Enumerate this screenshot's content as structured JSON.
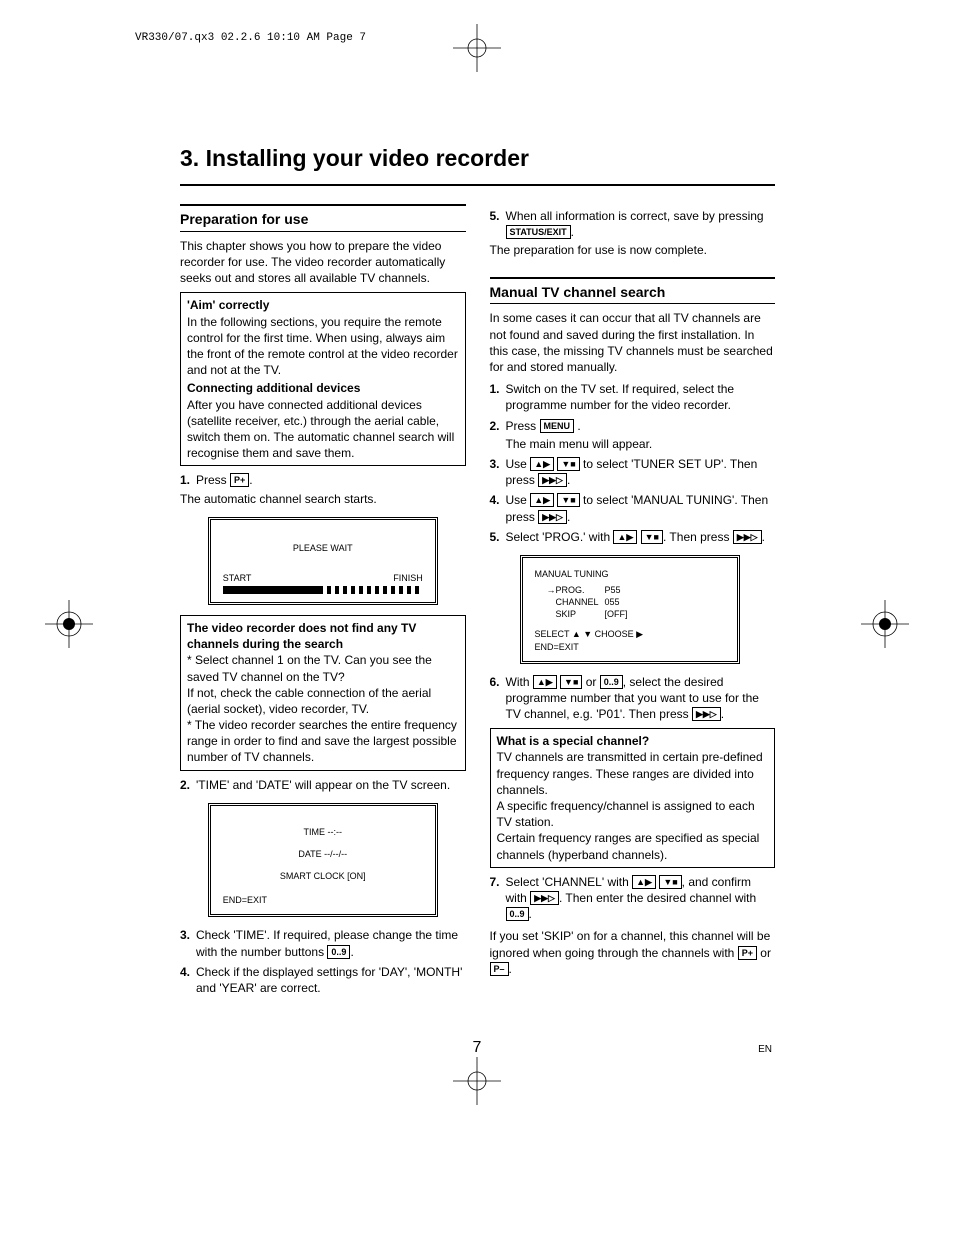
{
  "header": "VR330/07.qx3  02.2.6  10:10 AM  Page 7",
  "title": "3. Installing your video recorder",
  "left": {
    "section1": "Preparation for use",
    "intro": "This chapter shows you how to prepare the video recorder for use. The video recorder automatically seeks out and stores all available TV channels.",
    "box1_h1": "'Aim' correctly",
    "box1_p1": "In the following sections, you require the remote control for the first time. When using, always aim the front of the remote control at the video recorder and not at the TV.",
    "box1_h2": "Connecting additional devices",
    "box1_p2": "After you have connected additional devices (satellite receiver, etc.) through the aerial cable, switch them on. The automatic channel search will recognise them and save them.",
    "s1_pre": "Press ",
    "s1_post": ".",
    "s1_after": "The automatic channel search starts.",
    "osd1_wait": "PLEASE WAIT",
    "osd1_start": "START",
    "osd1_finish": "FINISH",
    "box2_h": "The video recorder does not find any TV channels during the search",
    "box2_l1": "* Select channel 1 on the TV. Can you see the saved TV channel on the TV?",
    "box2_l2": "If not, check the cable connection of the aerial (aerial socket), video recorder, TV.",
    "box2_l3": "* The video recorder searches the entire frequency range in order to find and save the largest possible number of TV channels.",
    "s2": "'TIME' and 'DATE' will appear on the TV screen.",
    "osd2_time": "TIME --:--",
    "osd2_date": "DATE --/--/--",
    "osd2_clock": "SMART CLOCK [ON]",
    "osd2_end": "END=EXIT",
    "s3_a": "Check 'TIME'. If required, please change the time with the number buttons ",
    "s3_b": ".",
    "s4": "Check if the displayed settings for 'DAY', 'MONTH' and 'YEAR' are correct."
  },
  "right": {
    "s5_a": "When all information is correct, save by pressing ",
    "s5_b": ".",
    "s5_after": "The preparation for use is now complete.",
    "section2": "Manual TV channel search",
    "intro2": "In some cases it can occur that all TV channels are not found and saved during the first installation. In this case, the missing TV channels must be searched for and stored manually.",
    "r1": "Switch on the TV set. If required, select the programme number for the video recorder.",
    "r2_a": "Press ",
    "r2_c": "   .",
    "r2_after": "The main menu will appear.",
    "r3_a": "Use ",
    "r3_b": " to select 'TUNER SET UP'. Then press ",
    "r3_c": ".",
    "r4_a": "Use ",
    "r4_b": " to select 'MANUAL TUNING'. Then press ",
    "r4_c": ".",
    "r5_a": "Select 'PROG.' with ",
    "r5_b": ". Then press ",
    "r5_c": ".",
    "osd3_title": "MANUAL TUNING",
    "osd3_prog": "→PROG.",
    "osd3_prog_v": "P55",
    "osd3_ch": "CHANNEL",
    "osd3_ch_v": "055",
    "osd3_skip": "SKIP",
    "osd3_skip_v": "[OFF]",
    "osd3_foot1": "SELECT ▲ ▼   CHOOSE ▶",
    "osd3_foot2": "END=EXIT",
    "r6_a": "With ",
    "r6_b": " or ",
    "r6_c": ", select the desired programme number that you want to use for the TV channel, e.g. 'P01'. Then press ",
    "r6_d": ".",
    "box3_h": "What is a special channel?",
    "box3_p1": "TV channels are transmitted in certain pre-defined frequency ranges. These ranges are divided into channels.",
    "box3_p2": "A specific frequency/channel is assigned to each TV station.",
    "box3_p3": "Certain frequency ranges are specified as special channels (hyperband channels).",
    "r7_a": "Select 'CHANNEL' with ",
    "r7_b": ", and confirm with ",
    "r7_c": ". Then enter the desired channel with ",
    "r7_d": ".",
    "skip_a": "If you set 'SKIP' on for a channel, this channel will be ignored when going through the channels with ",
    "skip_b": " or ",
    "skip_c": "."
  },
  "buttons": {
    "pplus": "P+",
    "pminus": "P–",
    "status": "STATUS/EXIT",
    "menu": "MENU",
    "num": "0..9",
    "up": "▲▶",
    "down": "▼■",
    "fwd": "▶▶▷"
  },
  "foot": {
    "page": "7",
    "lang": "EN"
  }
}
